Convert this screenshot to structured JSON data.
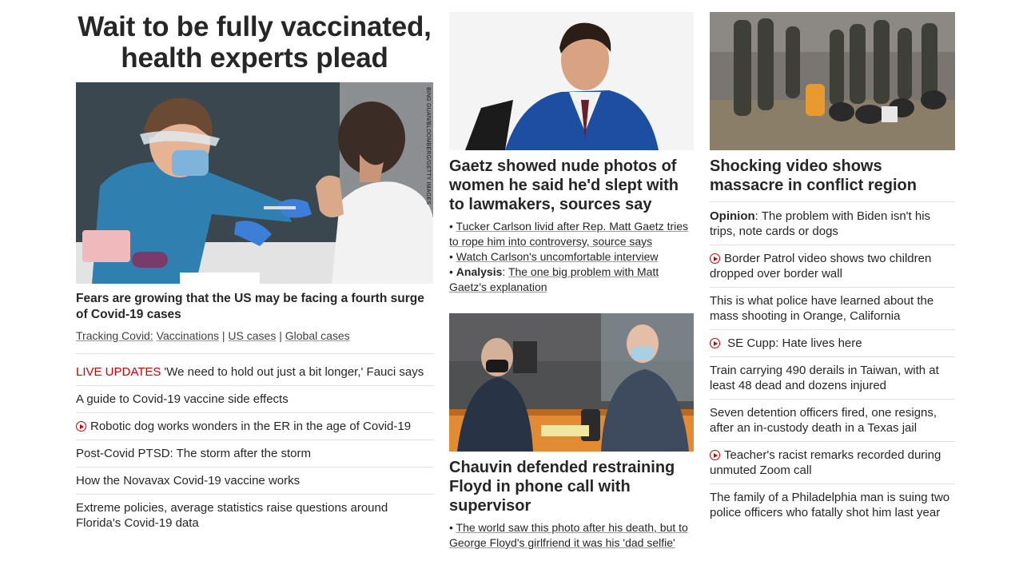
{
  "main_story": {
    "headline": "Wait to be fully vaccinated, health experts plead",
    "photo_credit": "BING GUAN/BLOOMBERG/GETTY IMAGES",
    "lead_title": "Fears are growing that the US may be facing a fourth surge of Covid-19 cases",
    "tracking_label": "Tracking Covid:",
    "tracking_links": [
      "Vaccinations",
      "US cases",
      "Global cases"
    ],
    "tracking_sep": "|"
  },
  "col1_items": [
    {
      "tag": "LIVE UPDATES",
      "text": "'We need to hold out just a bit longer,' Fauci says"
    },
    {
      "text": "A guide to Covid-19 vaccine side effects"
    },
    {
      "video": true,
      "text": "Robotic dog works wonders in the ER in the age of Covid-19"
    },
    {
      "text": "Post-Covid PTSD: The storm after the storm"
    },
    {
      "text": "How the Novavax Covid-19 vaccine works"
    },
    {
      "text": "Extreme policies, average statistics raise questions around Florida's Covid-19 data"
    }
  ],
  "gaetz_story": {
    "title": "Gaetz showed nude photos of women he said he'd slept with to lawmakers, sources say",
    "bullets": [
      {
        "text": "Tucker Carlson livid after Rep. Matt Gaetz tries to rope him into controversy, source says"
      },
      {
        "text": "Watch Carlson's uncomfortable interview"
      },
      {
        "label": "Analysis",
        "text": "The one big problem with Matt Gaetz's explanation"
      }
    ]
  },
  "chauvin_story": {
    "title": "Chauvin defended restraining Floyd in phone call with supervisor",
    "bullets": [
      {
        "text": "The world saw this photo after his death, but to George Floyd's girlfriend it was his 'dad selfie'"
      }
    ]
  },
  "massacre_story": {
    "title": "Shocking video shows massacre in conflict region"
  },
  "col3_items": [
    {
      "label": "Opinion",
      "text": "The problem with Biden isn't his trips, note cards or dogs"
    },
    {
      "video": true,
      "text": "Border Patrol video shows two children dropped over border wall"
    },
    {
      "text": "This is what police have learned about the mass shooting in Orange, California"
    },
    {
      "video": true,
      "text": "SE Cupp: Hate lives here"
    },
    {
      "text": "Train carrying 490 derails in Taiwan, with at least 48 dead and dozens injured"
    },
    {
      "text": "Seven detention officers fired, one resigns, after an in-custody death in a Texas jail"
    },
    {
      "video": true,
      "text": "Teacher's racist remarks recorded during unmuted Zoom call"
    },
    {
      "text": "The family of a Philadelphia man is suing two police officers who fatally shot him last year"
    }
  ],
  "bullet_char": "•",
  "label_sep": ":",
  "colors": {
    "live_red": "#cc0000",
    "text": "#262626",
    "divider": "#e0e0e0"
  }
}
